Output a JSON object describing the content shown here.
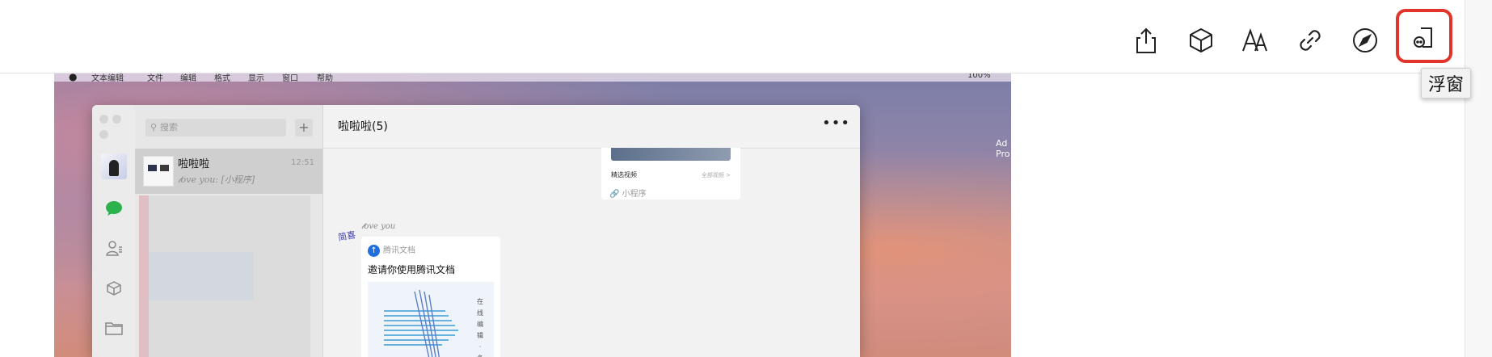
{
  "toolbar": {
    "buttons": [
      {
        "icon": "share-icon"
      },
      {
        "icon": "cube-icon"
      },
      {
        "icon": "font-size-icon"
      },
      {
        "icon": "link-icon"
      },
      {
        "icon": "compass-icon"
      },
      {
        "icon": "floating-window-icon",
        "highlighted": true
      }
    ],
    "highlight_color": "#e0342c",
    "tooltip": "浮窗"
  },
  "desktop": {
    "menubar": {
      "items": [
        "文本编辑",
        "文件",
        "编辑",
        "格式",
        "显示",
        "窗口",
        "帮助"
      ],
      "status": "100%"
    },
    "side_label": "Ad\nPro"
  },
  "wechat": {
    "search_placeholder": "搜索",
    "add_label": "+",
    "chat": {
      "name": "啦啦啦",
      "preview": "𝓁ove you: [小程序]",
      "time": "12:51"
    },
    "conversation_title": "啦啦啦(5)",
    "more_label": "•••",
    "mini_program_card": {
      "subtitle": "精选视频",
      "subtitle_right": "全部视频 >",
      "footer": "小程序"
    },
    "message": {
      "sender_badge": "简喜",
      "sender_name": "𝓁ove you",
      "card": {
        "app_name": "腾讯文档",
        "title": "邀请你使用腾讯文档",
        "side_text": "在线编辑·多"
      }
    }
  }
}
